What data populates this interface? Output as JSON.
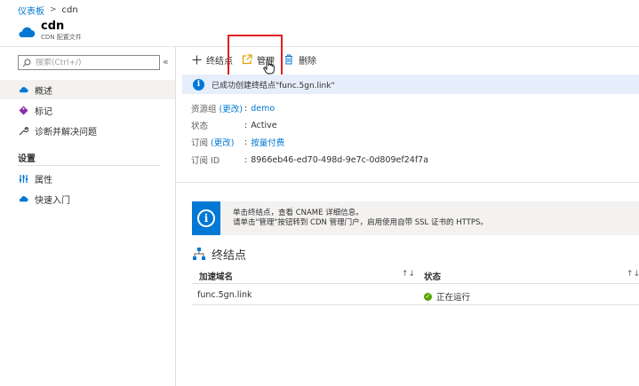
{
  "breadcrumb": {
    "home": "仪表板",
    "current": "cdn"
  },
  "resource": {
    "title": "cdn",
    "subtitle": "CDN 配置文件"
  },
  "sidebar": {
    "search_placeholder": "搜索(Ctrl+/)",
    "collapse": "«",
    "items": [
      {
        "label": "概述"
      },
      {
        "label": "标记"
      },
      {
        "label": "诊断并解决问题"
      }
    ],
    "section": "设置",
    "settings_items": [
      {
        "label": "属性"
      },
      {
        "label": "快速入门"
      }
    ]
  },
  "toolbar": {
    "add": "终结点",
    "manage": "管理",
    "delete": "删除"
  },
  "banner": {
    "text": "已成功创建终结点\"func.5gn.link\""
  },
  "essentials": {
    "resource_group_label": "资源组",
    "change": "(更改)",
    "resource_group_value": "demo",
    "status_label": "状态",
    "status_value": "Active",
    "subscription_label": "订阅",
    "subscription_value": "按量付费",
    "subscription_id_label": "订阅 ID",
    "subscription_id_value": "8966eb46-ed70-498d-9e7c-0d809ef24f7a",
    "colon": ":"
  },
  "info_panel": {
    "line1": "单击终结点，查看 CNAME 详细信息。",
    "line2": "请单击\"管理\"按钮转到 CDN 管理门户，启用使用自带 SSL 证书的 HTTPS。"
  },
  "endpoints": {
    "title": "终结点",
    "col_domain": "加速域名",
    "col_status": "状态",
    "sort_glyph": "↑↓",
    "rows": [
      {
        "domain": "func.5gn.link",
        "status": "正在运行"
      }
    ]
  },
  "colors": {
    "accent": "#0078d4",
    "highlight": "#e02020",
    "success": "#57a300",
    "banner_bg": "#e6eefb"
  }
}
